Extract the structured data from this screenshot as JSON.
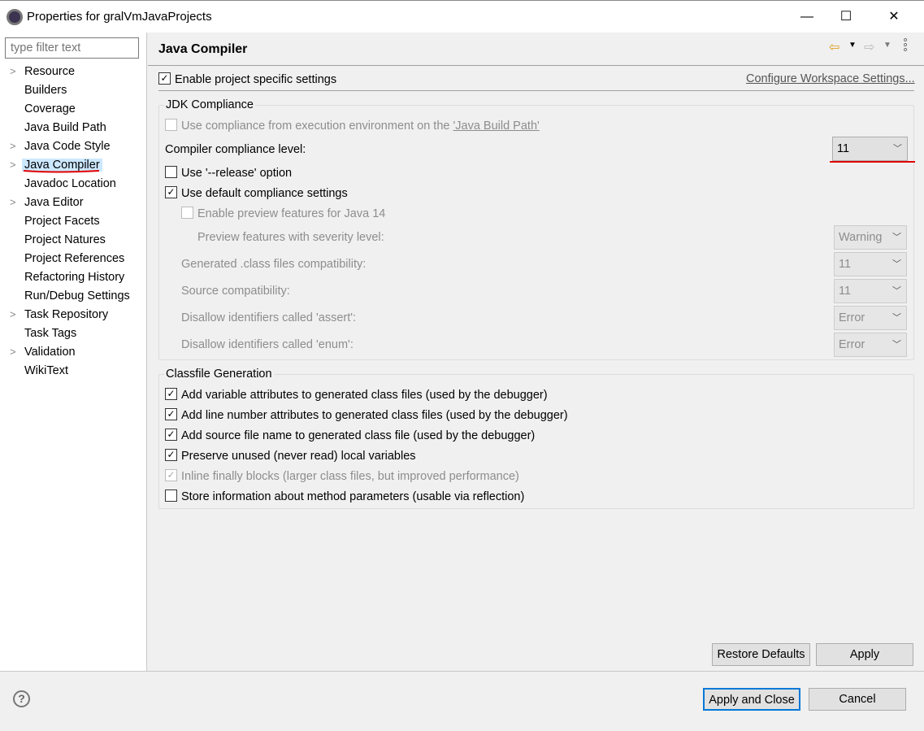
{
  "window": {
    "title": "Properties for gralVmJavaProjects",
    "minimize": "—",
    "maximize": "☐",
    "close": "✕"
  },
  "sidebar": {
    "filter_placeholder": "type filter text",
    "items": [
      {
        "label": "Resource",
        "expandable": true
      },
      {
        "label": "Builders",
        "expandable": false
      },
      {
        "label": "Coverage",
        "expandable": false
      },
      {
        "label": "Java Build Path",
        "expandable": false
      },
      {
        "label": "Java Code Style",
        "expandable": true
      },
      {
        "label": "Java Compiler",
        "expandable": true,
        "selected": true
      },
      {
        "label": "Javadoc Location",
        "expandable": false
      },
      {
        "label": "Java Editor",
        "expandable": true
      },
      {
        "label": "Project Facets",
        "expandable": false
      },
      {
        "label": "Project Natures",
        "expandable": false
      },
      {
        "label": "Project References",
        "expandable": false
      },
      {
        "label": "Refactoring History",
        "expandable": false
      },
      {
        "label": "Run/Debug Settings",
        "expandable": false
      },
      {
        "label": "Task Repository",
        "expandable": true
      },
      {
        "label": "Task Tags",
        "expandable": false
      },
      {
        "label": "Validation",
        "expandable": true
      },
      {
        "label": "WikiText",
        "expandable": false
      }
    ]
  },
  "page": {
    "title": "Java Compiler",
    "enable_specific": {
      "label": "Enable project specific settings",
      "checked": true
    },
    "configure_link": "Configure Workspace Settings...",
    "jdk": {
      "title": "JDK Compliance",
      "use_env": {
        "label": "Use compliance from execution environment on the ",
        "link": "'Java Build Path'",
        "checked": false,
        "enabled": false
      },
      "level_label": "Compiler compliance level:",
      "level_value": "11",
      "release": {
        "label": "Use '--release' option",
        "checked": false
      },
      "defaults": {
        "label": "Use default compliance settings",
        "checked": true
      },
      "preview": {
        "label": "Enable preview features for Java 14",
        "checked": false
      },
      "settings": [
        {
          "label": "Preview features with severity level:",
          "value": "Warning"
        },
        {
          "label": "Generated .class files compatibility:",
          "value": "11"
        },
        {
          "label": "Source compatibility:",
          "value": "11"
        },
        {
          "label": "Disallow identifiers called 'assert':",
          "value": "Error"
        },
        {
          "label": "Disallow identifiers called 'enum':",
          "value": "Error"
        }
      ]
    },
    "classfile": {
      "title": "Classfile Generation",
      "options": [
        {
          "label": "Add variable attributes to generated class files (used by the debugger)",
          "checked": true,
          "enabled": true
        },
        {
          "label": "Add line number attributes to generated class files (used by the debugger)",
          "checked": true,
          "enabled": true
        },
        {
          "label": "Add source file name to generated class file (used by the debugger)",
          "checked": true,
          "enabled": true
        },
        {
          "label": "Preserve unused (never read) local variables",
          "checked": true,
          "enabled": true
        },
        {
          "label": "Inline finally blocks (larger class files, but improved performance)",
          "checked": true,
          "enabled": false
        },
        {
          "label": "Store information about method parameters (usable via reflection)",
          "checked": false,
          "enabled": true
        }
      ]
    }
  },
  "buttons": {
    "restore": "Restore Defaults",
    "apply": "Apply",
    "apply_close": "Apply and Close",
    "cancel": "Cancel",
    "help": "?"
  },
  "colors": {
    "annotation": "#e00000",
    "selection": "#cce8ff",
    "link": "#555555"
  }
}
